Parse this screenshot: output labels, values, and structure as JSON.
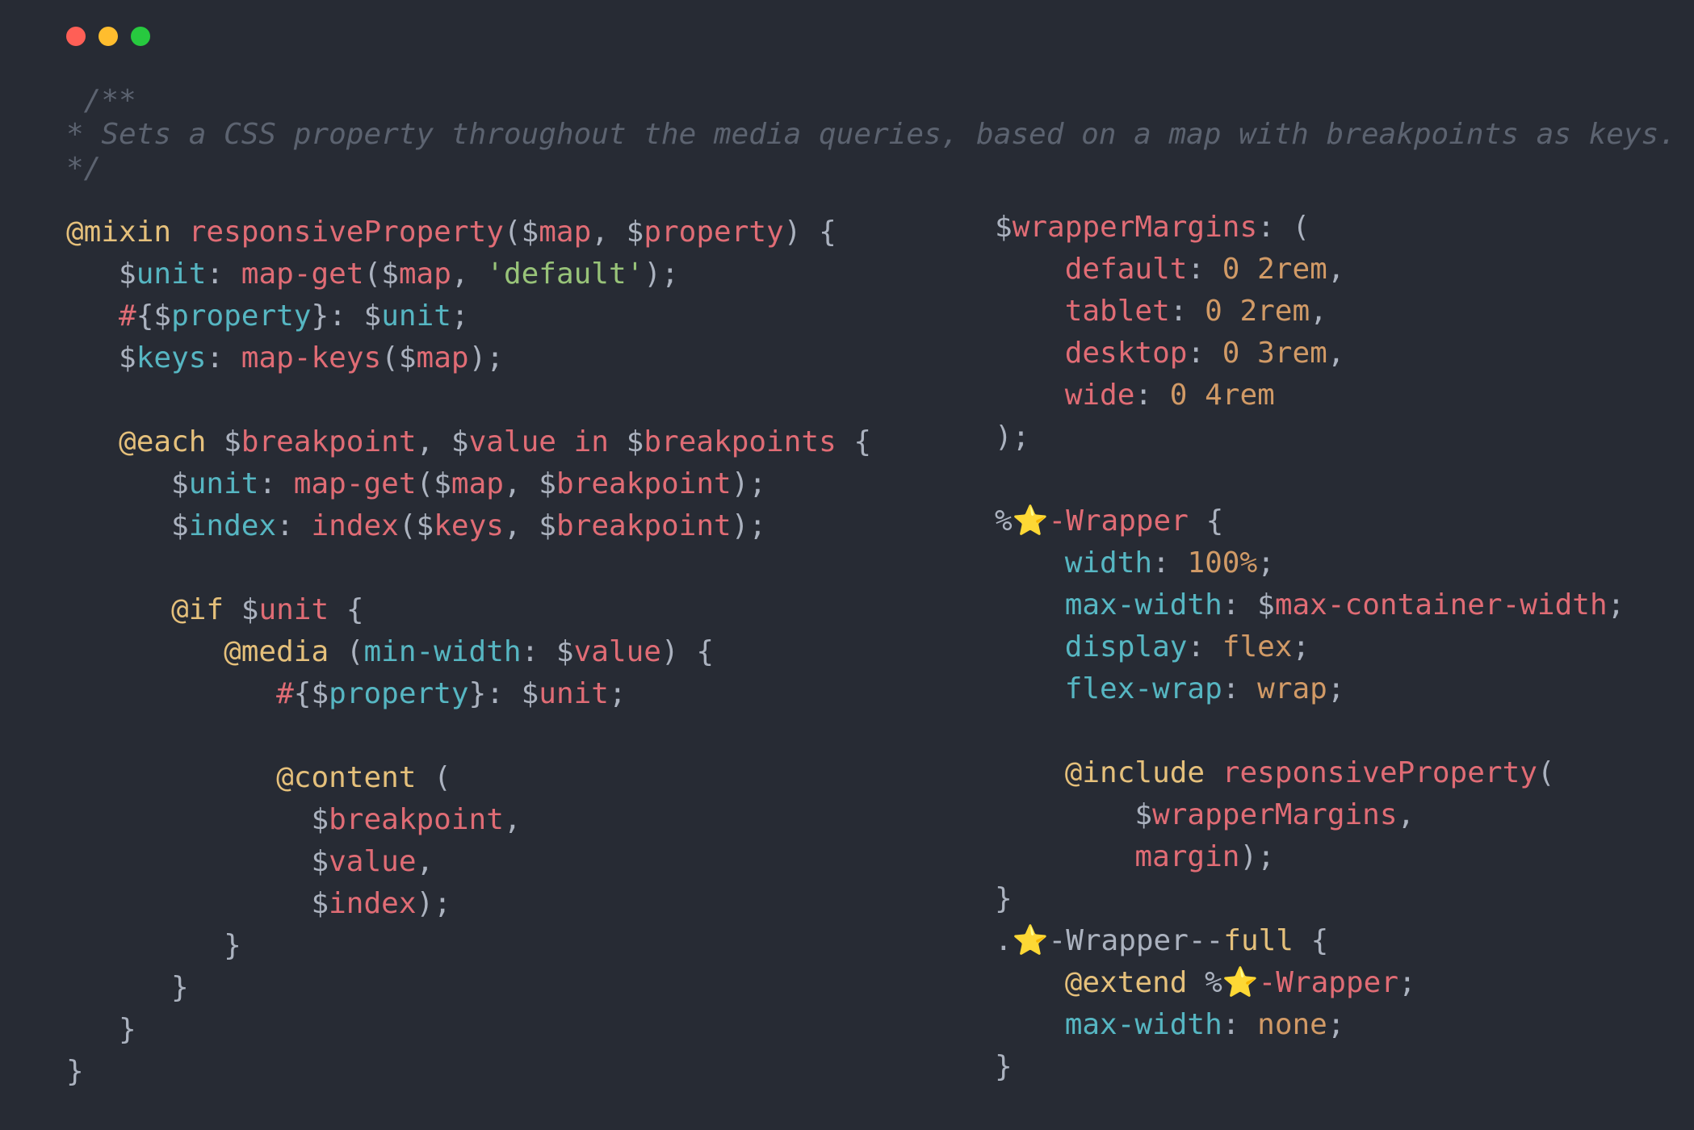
{
  "window": {
    "controls": {
      "close_color": "#ff5f56",
      "minimize_color": "#ffbd2e",
      "maximize_color": "#27c93f"
    }
  },
  "comment": {
    "line1": " /**",
    "line2": "* Sets a CSS property throughout the media queries, based on a map with breakpoints as keys.",
    "line3": "*/"
  },
  "left": {
    "l1": {
      "kw": "@mixin",
      "name": "responsiveProperty",
      "p1": "(",
      "a1": "$",
      "a1n": "map",
      "sep": ", ",
      "a2": "$",
      "a2n": "property",
      "end": ") {"
    },
    "l2": {
      "indent": "   ",
      "d": "$",
      "v": "unit",
      "c": ": ",
      "fn": "map-get",
      "o": "(",
      "a": "$",
      "an": "map",
      "s": ", ",
      "str": "'default'",
      "e": ");"
    },
    "l3": {
      "indent": "   ",
      "h": "#",
      "b1": "{",
      "d": "$",
      "v": "property",
      "b2": "}",
      "c": ": ",
      "d2": "$",
      "v2": "unit",
      "e": ";"
    },
    "l4": {
      "indent": "   ",
      "d": "$",
      "v": "keys",
      "c": ": ",
      "fn": "map-keys",
      "o": "(",
      "a": "$",
      "an": "map",
      "e": ");"
    },
    "l6": {
      "indent": "   ",
      "kw": "@each",
      "d1": " $",
      "v1": "breakpoint",
      "s": ", ",
      "d2": "$",
      "v2": "value",
      "in": " in ",
      "d3": "$",
      "v3": "breakpoints",
      "e": " {"
    },
    "l7": {
      "indent": "      ",
      "d": "$",
      "v": "unit",
      "c": ": ",
      "fn": "map-get",
      "o": "(",
      "a": "$",
      "an": "map",
      "s": ", ",
      "a2": "$",
      "a2n": "breakpoint",
      "e": ");"
    },
    "l8": {
      "indent": "      ",
      "d": "$",
      "v": "index",
      "c": ": ",
      "fn": "index",
      "o": "(",
      "a": "$",
      "an": "keys",
      "s": ", ",
      "a2": "$",
      "a2n": "breakpoint",
      "e": ");"
    },
    "l10": {
      "indent": "      ",
      "kw": "@if",
      "d": " $",
      "v": "unit",
      "e": " {"
    },
    "l11": {
      "indent": "         ",
      "kw": "@media",
      "o": " (",
      "prop": "min-width",
      "c": ": ",
      "d": "$",
      "v": "value",
      "e": ") {"
    },
    "l12": {
      "indent": "            ",
      "h": "#",
      "b1": "{",
      "d": "$",
      "v": "property",
      "b2": "}",
      "c": ": ",
      "d2": "$",
      "v2": "unit",
      "e": ";"
    },
    "l14": {
      "indent": "            ",
      "kw": "@content",
      "e": " ("
    },
    "l15": {
      "indent": "              ",
      "d": "$",
      "v": "breakpoint",
      "e": ","
    },
    "l16": {
      "indent": "              ",
      "d": "$",
      "v": "value",
      "e": ","
    },
    "l17": {
      "indent": "              ",
      "d": "$",
      "v": "index",
      "e": ");"
    },
    "l18": {
      "text": "         }"
    },
    "l19": {
      "text": "      }"
    },
    "l20": {
      "text": "   }"
    },
    "l21": {
      "text": "}"
    }
  },
  "right": {
    "r1": {
      "d": "$",
      "v": "wrapperMargins",
      "e": ": ("
    },
    "r2": {
      "indent": "    ",
      "k": "default",
      "c": ": ",
      "val": "0 2rem",
      "e": ","
    },
    "r3": {
      "indent": "    ",
      "k": "tablet",
      "c": ": ",
      "val": "0 2rem",
      "e": ","
    },
    "r4": {
      "indent": "    ",
      "k": "desktop",
      "c": ": ",
      "val": "0 3rem",
      "e": ","
    },
    "r5": {
      "indent": "    ",
      "k": "wide",
      "c": ": ",
      "val": "0 4rem"
    },
    "r6": {
      "text": ");"
    },
    "r8": {
      "pct": "%",
      "star": "⭐",
      "name": "-Wrapper",
      "e": " {"
    },
    "r9": {
      "indent": "    ",
      "p": "width",
      "c": ": ",
      "val": "100%",
      "e": ";"
    },
    "r10": {
      "indent": "    ",
      "p": "max-width",
      "c": ": ",
      "d": "$",
      "v": "max-container-width",
      "e": ";"
    },
    "r11": {
      "indent": "    ",
      "p": "display",
      "c": ": ",
      "val": "flex",
      "e": ";"
    },
    "r12": {
      "indent": "    ",
      "p": "flex-wrap",
      "c": ": ",
      "val": "wrap",
      "e": ";"
    },
    "r14": {
      "indent": "    ",
      "kw": "@include",
      "sp": " ",
      "fn": "responsiveProperty",
      "o": "("
    },
    "r15": {
      "indent": "        ",
      "d": "$",
      "v": "wrapperMargins",
      "e": ","
    },
    "r16": {
      "indent": "        ",
      "v": "margin",
      "e": ");"
    },
    "r17": {
      "text": "}"
    },
    "r18": {
      "dot": ".",
      "star": "⭐",
      "name": "-Wrapper--",
      "mod": "full",
      "e": " {"
    },
    "r19": {
      "indent": "    ",
      "kw": "@extend",
      "sp": " %",
      "star": "⭐",
      "name": "-Wrapper",
      "e": ";"
    },
    "r20": {
      "indent": "    ",
      "p": "max-width",
      "c": ": ",
      "val": "none",
      "e": ";"
    },
    "r21": {
      "text": "}"
    }
  }
}
